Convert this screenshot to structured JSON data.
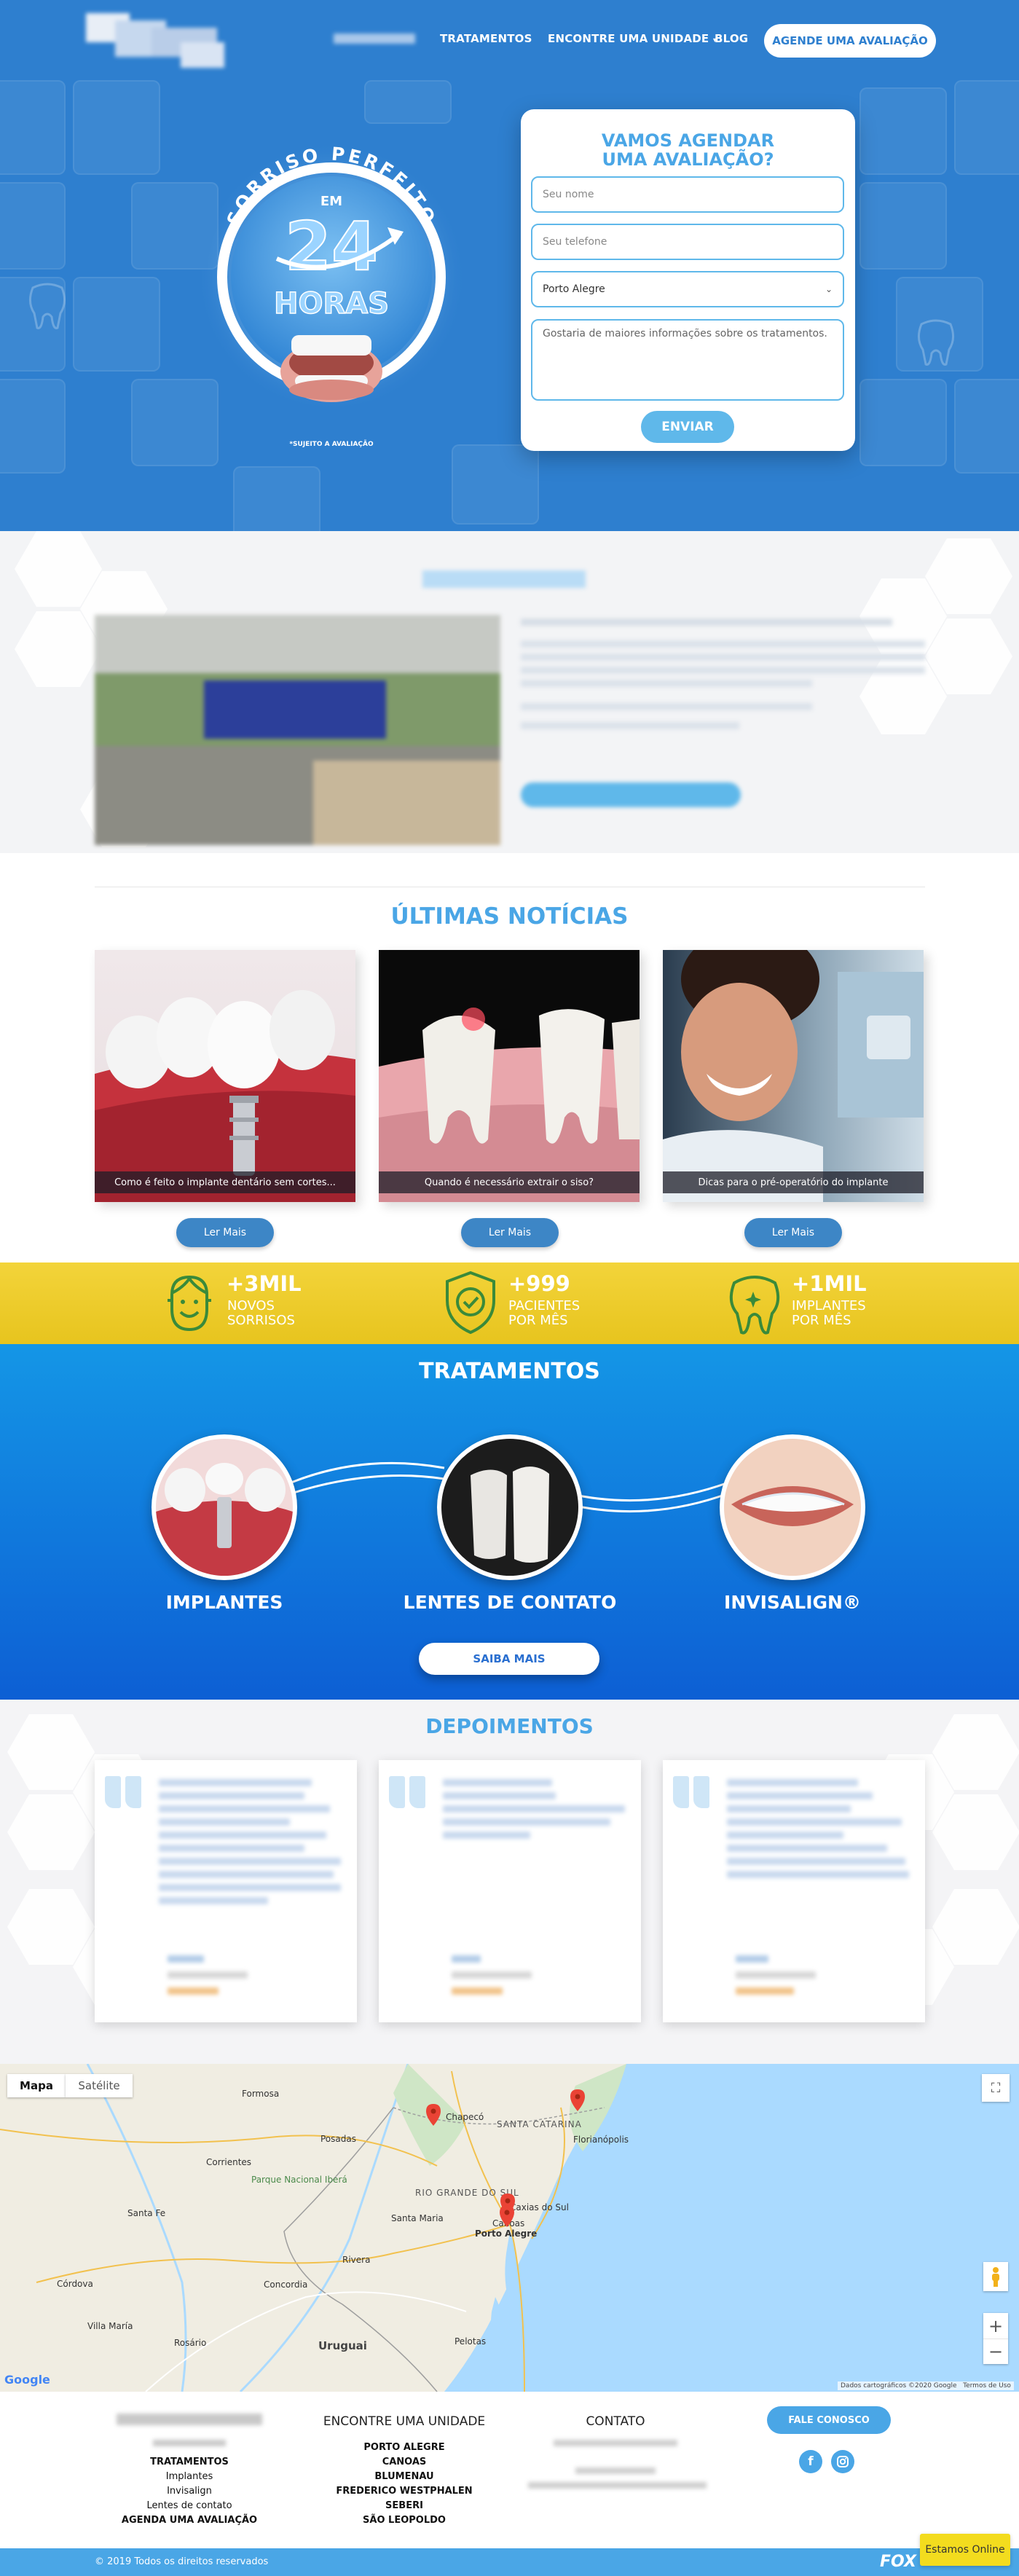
{
  "nav": {
    "links": [
      "TRATAMENTOS",
      "ENCONTRE UMA UNIDADE",
      "BLOG"
    ],
    "cta": "AGENDE UMA AVALIAÇÃO"
  },
  "hero": {
    "badge_arc": "SORRISO PERFEITO",
    "badge_em": "EM",
    "badge_number": "24",
    "badge_horas": "HORAS",
    "badge_note": "*SUJEITO A AVALIAÇÃO"
  },
  "form": {
    "title_line1": "VAMOS AGENDAR",
    "title_line2": "UMA AVALIAÇÃO?",
    "name_placeholder": "Seu nome",
    "phone_placeholder": "Seu telefone",
    "unit_selected": "Porto Alegre",
    "message_placeholder": "Gostaria de maiores informações sobre os tratamentos.",
    "submit": "ENVIAR"
  },
  "news": {
    "title": "ÚLTIMAS NOTÍCIAS",
    "items": [
      {
        "caption": "Como é feito o implante dentário sem cortes...",
        "button": "Ler Mais"
      },
      {
        "caption": "Quando é necessário extrair o siso?",
        "button": "Ler Mais"
      },
      {
        "caption": "Dicas para o pré-operatório do implante",
        "button": "Ler Mais"
      }
    ]
  },
  "stats": [
    {
      "number": "+3MIL",
      "line1": "NOVOS",
      "line2": "SORRISOS"
    },
    {
      "number": "+999",
      "line1": "PACIENTES",
      "line2": "POR MÊS"
    },
    {
      "number": "+1MIL",
      "line1": "IMPLANTES",
      "line2": "POR MÊS"
    }
  ],
  "treatments": {
    "title": "TRATAMENTOS",
    "items": [
      "IMPLANTES",
      "LENTES DE CONTATO",
      "INVISALIGN®"
    ],
    "button": "SAIBA MAIS"
  },
  "testimonials": {
    "title": "DEPOIMENTOS"
  },
  "map": {
    "tab_map": "Mapa",
    "tab_satellite": "Satélite",
    "cities": [
      "Porto Alegre",
      "Canoas",
      "Santa Maria",
      "Pelotas",
      "Florianópolis",
      "Chapecó",
      "Posadas",
      "Corrientes",
      "Uruguai",
      "Rosário",
      "Concordia",
      "Formosa",
      "Córdova",
      "Villa María",
      "Santa Fe",
      "Caxias do Sul",
      "Rivera"
    ],
    "labels": [
      "RIO GRANDE DO SUL",
      "SANTA CATARINA",
      "Parque Nacional Iberá"
    ],
    "attribution": "Dados cartográficos ©2020 Google",
    "terms": "Termos de Uso",
    "google": "Google"
  },
  "footer": {
    "col1": [
      "TRATAMENTOS",
      "Implantes",
      "Invisalign",
      "Lentes de contato",
      "AGENDA UMA AVALIAÇÃO"
    ],
    "col2_title": "ENCONTRE UMA UNIDADE",
    "col2": [
      "PORTO ALEGRE",
      "CANOAS",
      "BLUMENAU",
      "FREDERICO WESTPHALEN",
      "SEBERI",
      "SÃO LEOPOLDO"
    ],
    "col3_title": "CONTATO",
    "cta": "FALE CONOSCO",
    "copyright": "© 2019 Todos os direitos reservados",
    "brand": "FOX",
    "online": "Estamos Online"
  },
  "colors": {
    "hero_blue": "#2e7fcf",
    "accent": "#4aa6e6",
    "yellow": "#f3d43a",
    "treat_blue": "#1496e6"
  }
}
